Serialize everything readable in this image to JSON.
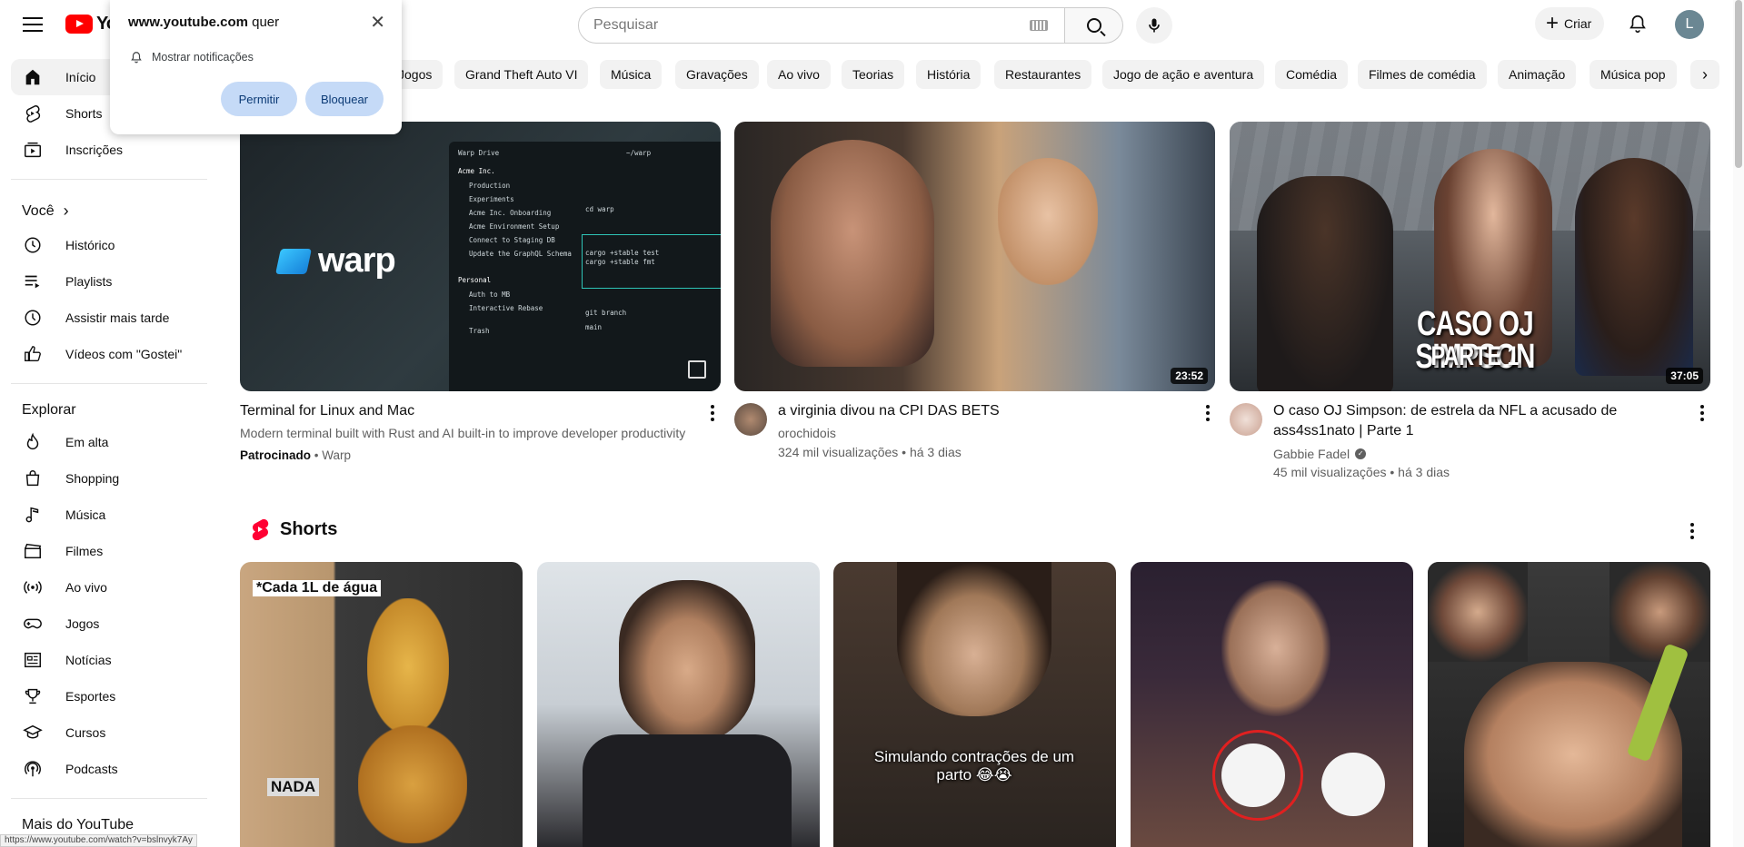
{
  "topbar": {
    "logo_text": "YouTube",
    "search_placeholder": "Pesquisar",
    "create_label": "Criar",
    "avatar_initial": "L"
  },
  "popup": {
    "site": "www.youtube.com",
    "suffix": " quer",
    "permission": "Mostrar notificações",
    "allow": "Permitir",
    "block": "Bloquear"
  },
  "sidebar": {
    "main": [
      "Início",
      "Shorts",
      "Inscrições"
    ],
    "you_heading": "Você",
    "you": [
      "Histórico",
      "Playlists",
      "Assistir mais tarde",
      "Vídeos com \"Gostei\""
    ],
    "explore_heading": "Explorar",
    "explore": [
      "Em alta",
      "Shopping",
      "Música",
      "Filmes",
      "Ao vivo",
      "Jogos",
      "Notícias",
      "Esportes",
      "Cursos",
      "Podcasts"
    ],
    "more_heading": "Mais do YouTube"
  },
  "chips": [
    "Jogos",
    "Grand Theft Auto VI",
    "Música",
    "Gravações",
    "Ao vivo",
    "Teorias",
    "História",
    "Restaurantes",
    "Jogo de ação e aventura",
    "Comédia",
    "Filmes de comédia",
    "Animação",
    "Música pop"
  ],
  "videos": [
    {
      "title": "Terminal for Linux and Mac",
      "desc": "Modern terminal built with Rust and AI built-in to improve developer productivity",
      "sponsored": "Patrocinado",
      "channel": "Warp",
      "brand": "warp"
    },
    {
      "title": "a virginia divou na CPI DAS BETS",
      "channel": "orochidois",
      "stats": "324 mil visualizações • há 3 dias",
      "duration": "23:52"
    },
    {
      "title": "O caso OJ Simpson: de estrela da NFL a acusado de ass4ss1nato | Parte 1",
      "channel": "Gabbie Fadel",
      "stats": "45 mil visualizações • há 3 dias",
      "duration": "37:05",
      "overlay_line1": "CASO OJ SIMPSON",
      "overlay_line2": "PARTE 1"
    }
  ],
  "shorts": {
    "heading": "Shorts",
    "captions": [
      "*Cada 1L de água",
      "NADA",
      "Simulando contrações de um parto 😂😭"
    ]
  },
  "warp_panel": {
    "header": "Warp Drive",
    "tab": "~/warp",
    "org": "Acme Inc.",
    "items": [
      "Production",
      "Experiments",
      "Acme Inc. Onboarding",
      "Acme Environment Setup",
      "Connect to Staging DB",
      "Update the GraphQL Schema"
    ],
    "personal": "Personal",
    "personal_items": [
      "Auth to MB",
      "Interactive Rebase"
    ],
    "trash": "Trash",
    "cmd1": "cd warp",
    "cmd2": "cargo +stable test",
    "cmd3": "cargo +stable fmt",
    "cmd4": "git branch",
    "cmd5": "main"
  },
  "status_url": "https://www.youtube.com/watch?v=bslnvyk7Ay"
}
